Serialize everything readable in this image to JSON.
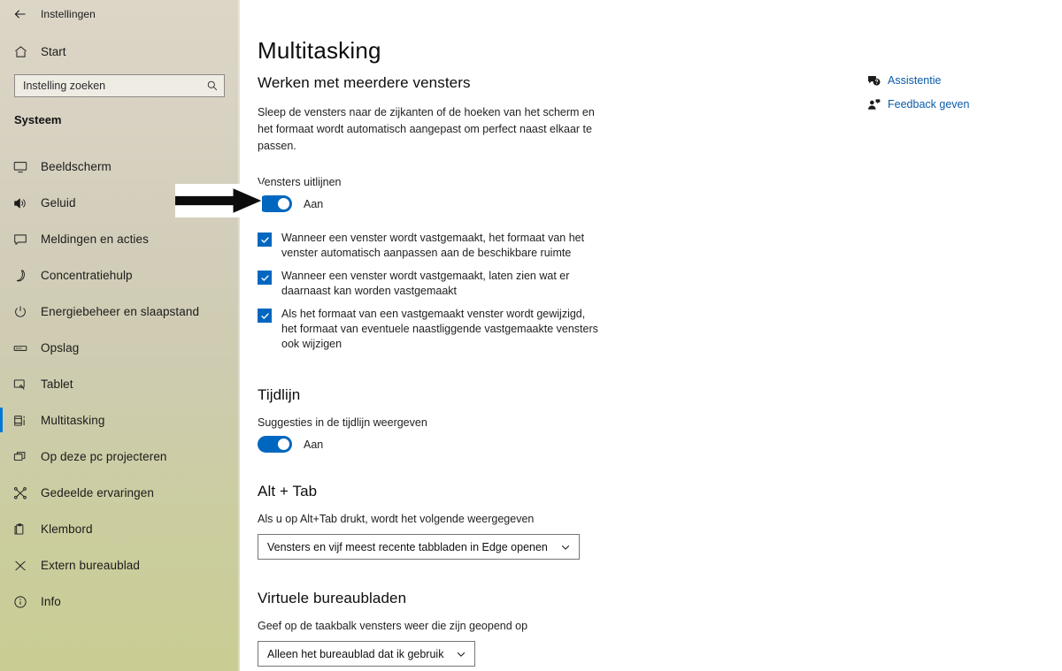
{
  "window": {
    "title": "Instellingen",
    "back_icon": "back-arrow-icon",
    "minimize_label": "–",
    "maximize_label": "□",
    "close_label": "×"
  },
  "sidebar": {
    "home_label": "Start",
    "home_icon": "home-icon",
    "search": {
      "value": "Instelling zoeken",
      "placeholder": "Instelling zoeken",
      "icon": "search-icon"
    },
    "section_title": "Systeem",
    "items": [
      {
        "label": "Beeldscherm",
        "icon": "monitor-icon",
        "selected": false
      },
      {
        "label": "Geluid",
        "icon": "speaker-icon",
        "selected": false
      },
      {
        "label": "Meldingen en acties",
        "icon": "notification-icon",
        "selected": false
      },
      {
        "label": "Concentratiehulp",
        "icon": "moon-icon",
        "selected": false
      },
      {
        "label": "Energiebeheer en slaapstand",
        "icon": "power-icon",
        "selected": false
      },
      {
        "label": "Opslag",
        "icon": "storage-icon",
        "selected": false
      },
      {
        "label": "Tablet",
        "icon": "tablet-icon",
        "selected": false
      },
      {
        "label": "Multitasking",
        "icon": "multitasking-icon",
        "selected": true
      },
      {
        "label": "Op deze pc projecteren",
        "icon": "project-icon",
        "selected": false
      },
      {
        "label": "Gedeelde ervaringen",
        "icon": "shared-experiences-icon",
        "selected": false
      },
      {
        "label": "Klembord",
        "icon": "clipboard-icon",
        "selected": false
      },
      {
        "label": "Extern bureaublad",
        "icon": "remote-desktop-icon",
        "selected": false
      },
      {
        "label": "Info",
        "icon": "info-icon",
        "selected": false
      }
    ]
  },
  "main": {
    "page_title": "Multitasking",
    "snap": {
      "heading": "Werken met meerdere vensters",
      "description": "Sleep de vensters naar de zijkanten of de hoeken van het scherm en het formaat wordt automatisch aangepast om perfect naast elkaar te passen.",
      "toggle_label": "Vensters uitlijnen",
      "toggle_state": "Aan",
      "checkboxes": [
        "Wanneer een venster wordt vastgemaakt, het formaat van het venster automatisch aanpassen aan de beschikbare ruimte",
        "Wanneer een venster wordt vastgemaakt, laten zien wat er daarnaast kan worden vastgemaakt",
        "Als het formaat van een vastgemaakt venster wordt gewijzigd, het formaat van eventuele naastliggende vastgemaakte vensters ook wijzigen"
      ]
    },
    "timeline": {
      "heading": "Tijdlijn",
      "toggle_label": "Suggesties in de tijdlijn weergeven",
      "toggle_state": "Aan"
    },
    "alttab": {
      "heading": "Alt + Tab",
      "description": "Als u op Alt+Tab drukt, wordt het volgende weergegeven",
      "selected_option": "Vensters en vijf meest recente tabbladen in Edge openen"
    },
    "virtual_desktops": {
      "heading": "Virtuele bureaubladen",
      "description": "Geef op de taakbalk vensters weer die zijn geopend op",
      "selected_option": "Alleen het bureaublad dat ik gebruik"
    }
  },
  "help_panel": {
    "items": [
      {
        "label": "Assistentie",
        "icon": "question-bubble-icon"
      },
      {
        "label": "Feedback geven",
        "icon": "feedback-person-icon"
      }
    ]
  },
  "annotation": {
    "arrow_icon": "pointer-arrow-icon"
  },
  "colors": {
    "accent_blue": "#0067c0",
    "selection_bar": "#0078d4",
    "link_blue": "#0a5ba8",
    "sidebar_top": "#ddd6c7",
    "sidebar_bottom": "#c9cd93"
  }
}
